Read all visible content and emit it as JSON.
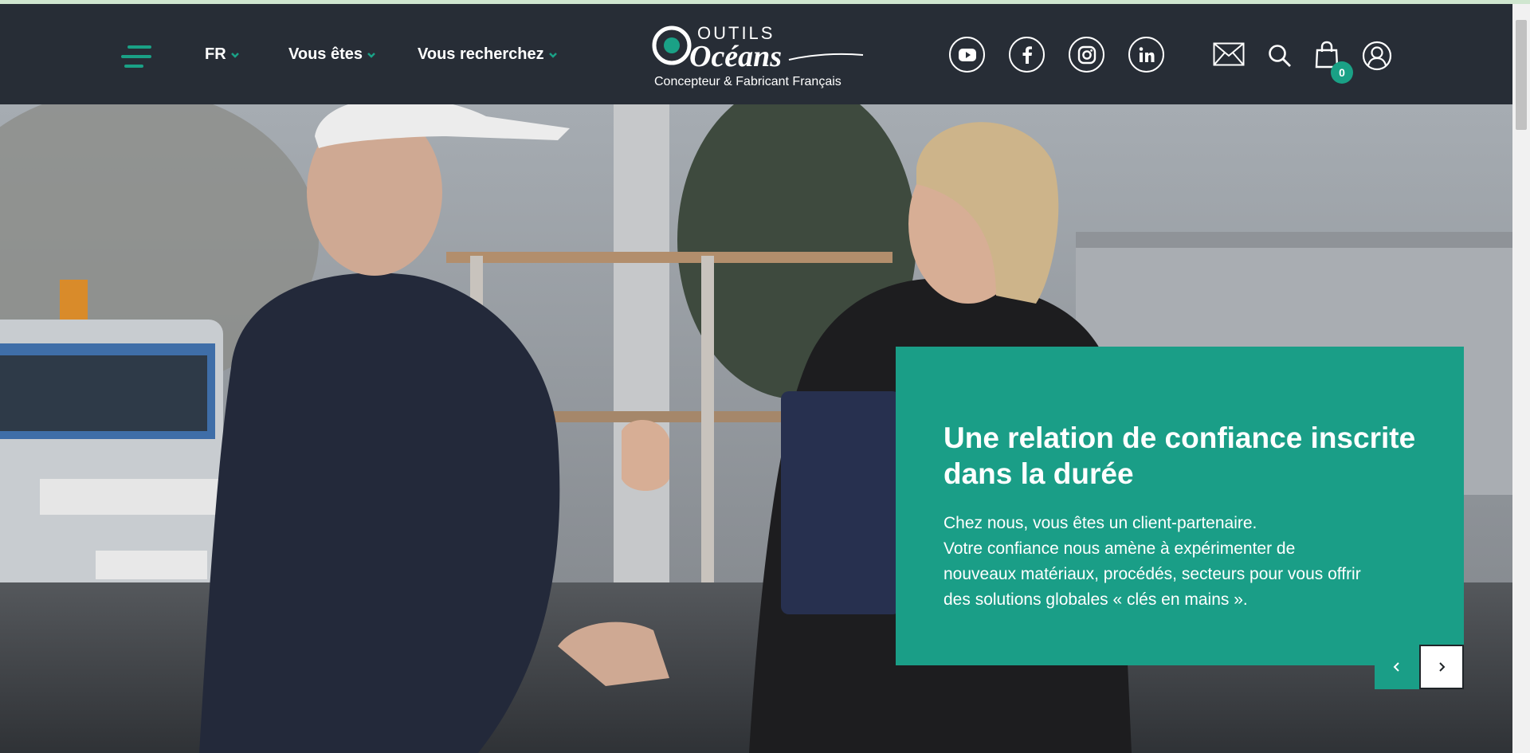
{
  "brand": {
    "logo_word_top": "OUTILS",
    "logo_word_main": "Océans",
    "tagline": "Concepteur & Fabricant Français"
  },
  "nav": {
    "language": "FR",
    "you_are": "Vous êtes",
    "searching": "Vous recherchez"
  },
  "social": [
    "youtube-icon",
    "facebook-icon",
    "instagram-icon",
    "linkedin-icon"
  ],
  "tools": {
    "cart_count": "0"
  },
  "hero": {
    "title_line1": "Une relation de confiance inscrite",
    "title_line2": "dans la durée",
    "text_line1": "Chez nous, vous êtes un client-partenaire.",
    "text_line2": "Votre confiance nous amène à expérimenter de",
    "text_line3": "nouveaux matériaux, procédés, secteurs pour vous offrir",
    "text_line4": "des solutions globales « clés en mains »."
  },
  "colors": {
    "header_bg": "#272d36",
    "accent": "#1aa186",
    "card_bg": "#1a9e87"
  }
}
